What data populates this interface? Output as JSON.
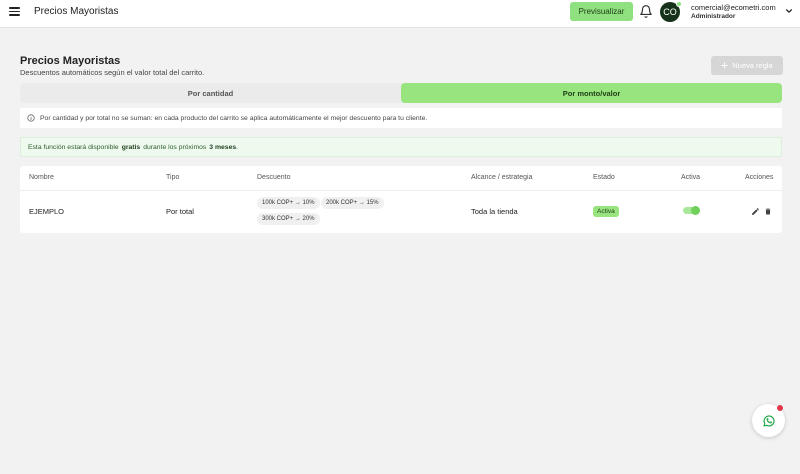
{
  "header": {
    "title": "Precios Mayoristas",
    "preview_label": "Previsualizar",
    "avatar_initials": "CO",
    "user_email": "comercial@ecometri.com",
    "user_role": "Administrador"
  },
  "page": {
    "title": "Precios Mayoristas",
    "subtitle": "Descuentos automáticos según el valor total del carrito.",
    "new_rule_label": "Nueva regla"
  },
  "tabs": [
    {
      "label": "Por cantidad",
      "active": false
    },
    {
      "label": "Por monto/valor",
      "active": true
    }
  ],
  "info_text": "Por cantidad y por total no se suman: en cada producto del carrito se aplica automáticamente el mejor descuento para tu cliente.",
  "promo": {
    "before": "Esta función estará disponible",
    "free": "gratis",
    "middle": "durante los próximos",
    "duration": "3 meses",
    "after": "."
  },
  "table": {
    "columns": [
      "Nombre",
      "Tipo",
      "Descuento",
      "Alcance / estrategia",
      "Estado",
      "Activa",
      "Acciones"
    ],
    "rows": [
      {
        "name": "EJEMPLO",
        "type": "Por total",
        "discounts": [
          "100k COP+ → 10%",
          "200k COP+ → 15%",
          "300k COP+ → 20%"
        ],
        "scope": "Toda la tienda",
        "status": "Activa",
        "active": true
      }
    ]
  },
  "colors": {
    "accent_green": "#98e57f",
    "status_dot_red": "#e0384a",
    "avatar_bg": "#16321a"
  },
  "icons": [
    "menu-icon",
    "bell-icon",
    "chevron-down-icon",
    "plus-icon",
    "info-icon",
    "edit-icon",
    "trash-icon",
    "whatsapp-icon"
  ]
}
